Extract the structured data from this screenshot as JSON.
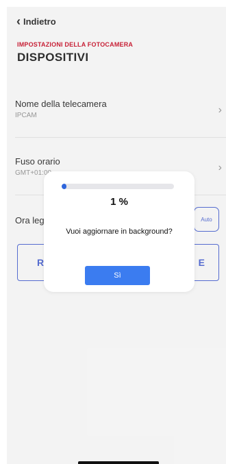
{
  "header": {
    "back_label": "Indietro"
  },
  "section": {
    "subtitle": "IMPOSTAZIONI DELLA FOTOCAMERA",
    "title": "DISPOSITIVI"
  },
  "rows": {
    "camera_name": {
      "label": "Nome della telecamera",
      "value": "IPCAM"
    },
    "timezone": {
      "label": "Fuso orario",
      "value": "GMT+01:00"
    },
    "time": {
      "label": "Ora legale"
    }
  },
  "buttons": {
    "auto_label": "Auto",
    "outlined_left": "R",
    "outlined_right": "E"
  },
  "dialog": {
    "progress_text": "1 %",
    "progress_fraction": 0.01,
    "message": "Vuoi aggiornare in background?",
    "confirm_label": "Sì"
  },
  "icons": {
    "back": "chevron-left-icon",
    "row_chevron": "chevron-right-icon"
  },
  "colors": {
    "accent": "#3d57c9",
    "brand_red": "#c0001a",
    "dialog_button": "#3b7cf0"
  }
}
